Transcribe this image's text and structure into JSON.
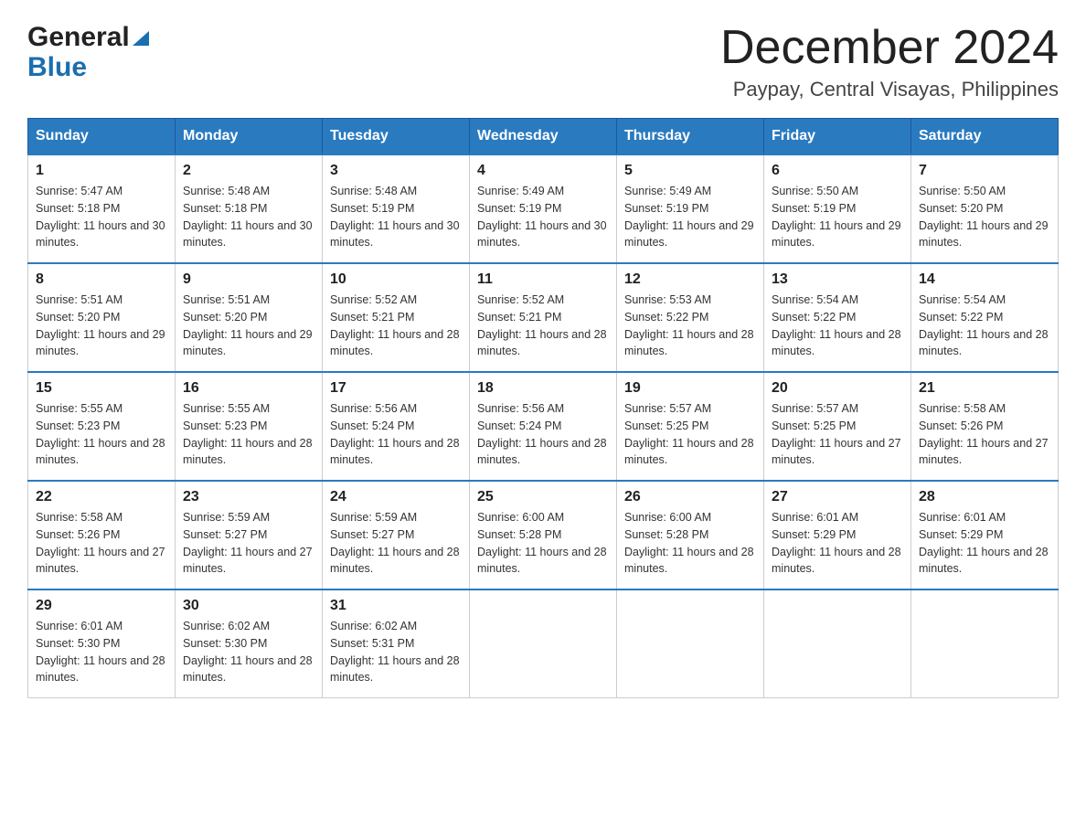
{
  "header": {
    "logo_general": "General",
    "logo_blue": "Blue",
    "calendar_title": "December 2024",
    "calendar_subtitle": "Paypay, Central Visayas, Philippines"
  },
  "days_of_week": [
    "Sunday",
    "Monday",
    "Tuesday",
    "Wednesday",
    "Thursday",
    "Friday",
    "Saturday"
  ],
  "weeks": [
    [
      {
        "day": "1",
        "sunrise": "5:47 AM",
        "sunset": "5:18 PM",
        "daylight": "11 hours and 30 minutes."
      },
      {
        "day": "2",
        "sunrise": "5:48 AM",
        "sunset": "5:18 PM",
        "daylight": "11 hours and 30 minutes."
      },
      {
        "day": "3",
        "sunrise": "5:48 AM",
        "sunset": "5:19 PM",
        "daylight": "11 hours and 30 minutes."
      },
      {
        "day": "4",
        "sunrise": "5:49 AM",
        "sunset": "5:19 PM",
        "daylight": "11 hours and 30 minutes."
      },
      {
        "day": "5",
        "sunrise": "5:49 AM",
        "sunset": "5:19 PM",
        "daylight": "11 hours and 29 minutes."
      },
      {
        "day": "6",
        "sunrise": "5:50 AM",
        "sunset": "5:19 PM",
        "daylight": "11 hours and 29 minutes."
      },
      {
        "day": "7",
        "sunrise": "5:50 AM",
        "sunset": "5:20 PM",
        "daylight": "11 hours and 29 minutes."
      }
    ],
    [
      {
        "day": "8",
        "sunrise": "5:51 AM",
        "sunset": "5:20 PM",
        "daylight": "11 hours and 29 minutes."
      },
      {
        "day": "9",
        "sunrise": "5:51 AM",
        "sunset": "5:20 PM",
        "daylight": "11 hours and 29 minutes."
      },
      {
        "day": "10",
        "sunrise": "5:52 AM",
        "sunset": "5:21 PM",
        "daylight": "11 hours and 28 minutes."
      },
      {
        "day": "11",
        "sunrise": "5:52 AM",
        "sunset": "5:21 PM",
        "daylight": "11 hours and 28 minutes."
      },
      {
        "day": "12",
        "sunrise": "5:53 AM",
        "sunset": "5:22 PM",
        "daylight": "11 hours and 28 minutes."
      },
      {
        "day": "13",
        "sunrise": "5:54 AM",
        "sunset": "5:22 PM",
        "daylight": "11 hours and 28 minutes."
      },
      {
        "day": "14",
        "sunrise": "5:54 AM",
        "sunset": "5:22 PM",
        "daylight": "11 hours and 28 minutes."
      }
    ],
    [
      {
        "day": "15",
        "sunrise": "5:55 AM",
        "sunset": "5:23 PM",
        "daylight": "11 hours and 28 minutes."
      },
      {
        "day": "16",
        "sunrise": "5:55 AM",
        "sunset": "5:23 PM",
        "daylight": "11 hours and 28 minutes."
      },
      {
        "day": "17",
        "sunrise": "5:56 AM",
        "sunset": "5:24 PM",
        "daylight": "11 hours and 28 minutes."
      },
      {
        "day": "18",
        "sunrise": "5:56 AM",
        "sunset": "5:24 PM",
        "daylight": "11 hours and 28 minutes."
      },
      {
        "day": "19",
        "sunrise": "5:57 AM",
        "sunset": "5:25 PM",
        "daylight": "11 hours and 28 minutes."
      },
      {
        "day": "20",
        "sunrise": "5:57 AM",
        "sunset": "5:25 PM",
        "daylight": "11 hours and 27 minutes."
      },
      {
        "day": "21",
        "sunrise": "5:58 AM",
        "sunset": "5:26 PM",
        "daylight": "11 hours and 27 minutes."
      }
    ],
    [
      {
        "day": "22",
        "sunrise": "5:58 AM",
        "sunset": "5:26 PM",
        "daylight": "11 hours and 27 minutes."
      },
      {
        "day": "23",
        "sunrise": "5:59 AM",
        "sunset": "5:27 PM",
        "daylight": "11 hours and 27 minutes."
      },
      {
        "day": "24",
        "sunrise": "5:59 AM",
        "sunset": "5:27 PM",
        "daylight": "11 hours and 28 minutes."
      },
      {
        "day": "25",
        "sunrise": "6:00 AM",
        "sunset": "5:28 PM",
        "daylight": "11 hours and 28 minutes."
      },
      {
        "day": "26",
        "sunrise": "6:00 AM",
        "sunset": "5:28 PM",
        "daylight": "11 hours and 28 minutes."
      },
      {
        "day": "27",
        "sunrise": "6:01 AM",
        "sunset": "5:29 PM",
        "daylight": "11 hours and 28 minutes."
      },
      {
        "day": "28",
        "sunrise": "6:01 AM",
        "sunset": "5:29 PM",
        "daylight": "11 hours and 28 minutes."
      }
    ],
    [
      {
        "day": "29",
        "sunrise": "6:01 AM",
        "sunset": "5:30 PM",
        "daylight": "11 hours and 28 minutes."
      },
      {
        "day": "30",
        "sunrise": "6:02 AM",
        "sunset": "5:30 PM",
        "daylight": "11 hours and 28 minutes."
      },
      {
        "day": "31",
        "sunrise": "6:02 AM",
        "sunset": "5:31 PM",
        "daylight": "11 hours and 28 minutes."
      },
      null,
      null,
      null,
      null
    ]
  ],
  "labels": {
    "sunrise": "Sunrise:",
    "sunset": "Sunset:",
    "daylight": "Daylight:"
  }
}
